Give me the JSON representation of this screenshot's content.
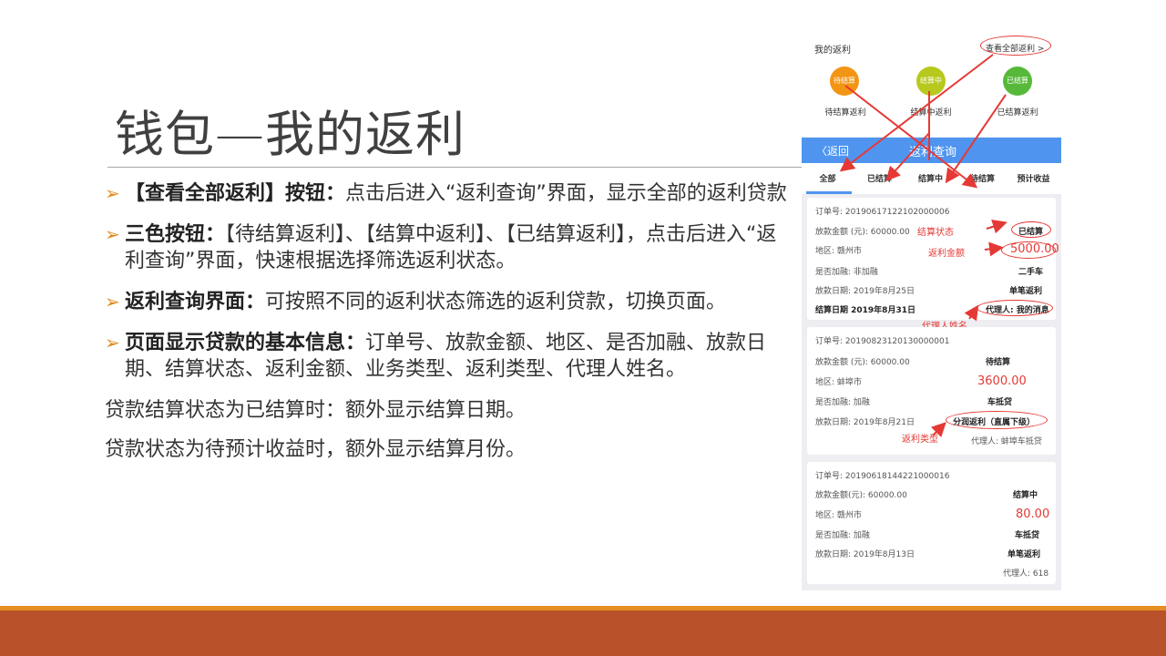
{
  "slide": {
    "title": "钱包—我的返利",
    "bullets": [
      {
        "bold": "【查看全部返利】按钮：",
        "text": "点击后进入“返利查询”界面，显示全部的返利贷款"
      },
      {
        "bold": "三色按钮：",
        "text": "【待结算返利】、【结算中返利】、【已结算返利】，点击后进入“返利查询”界面，快速根据选择筛选返利状态。"
      },
      {
        "bold": "返利查询界面：",
        "text": "可按照不同的返利状态筛选的返利贷款，切换页面。"
      },
      {
        "bold": "页面显示贷款的基本信息：",
        "text": "订单号、放款金额、地区、是否加融、放款日期、结算状态、返利金额、业务类型、返利类型、代理人姓名。"
      }
    ],
    "notes": [
      "贷款结算状态为已结算时：额外显示结算日期。",
      "贷款状态为待预计收益时，额外显示结算月份。"
    ]
  },
  "phone": {
    "rebate_title": "我的返利",
    "view_all": "查看全部返利 >",
    "circles": [
      {
        "text": "待结算",
        "label": "待结算返利",
        "color": "#f39514"
      },
      {
        "text": "结算中",
        "label": "结算中返利",
        "color": "#b7c91c"
      },
      {
        "text": "已结算",
        "label": "已结算返利",
        "color": "#57b93a"
      }
    ],
    "nav": {
      "back": "〈返回",
      "title": "返利查询"
    },
    "tabs": [
      "全部",
      "已结算",
      "结算中",
      "待结算",
      "预计收益"
    ],
    "cards": [
      {
        "order": "订单号: 20190617122102000006",
        "amount": "放款金额 (元): 60000.00",
        "region": "地区: 赣州市",
        "extra": "是否加融: 非加融",
        "loan_date": "放款日期: 2019年8月25日",
        "settle_date": "结算日期 2019年8月31日",
        "status": "已结算",
        "rebate": "5000.00",
        "biz": "二手车",
        "rebate_type": "单笔返利",
        "agent": "代理人: 我的消息"
      },
      {
        "order": "订单号: 20190823120130000001",
        "amount": "放款金额 (元): 60000.00",
        "region": "地区: 蚌埠市",
        "extra": "是否加融: 加融",
        "loan_date": "放款日期: 2019年8月21日",
        "status": "待结算",
        "rebate": "3600.00",
        "biz": "车抵贷",
        "rebate_type": "分润返利（直属下级）",
        "agent": "代理人: 蚌埠车抵贷"
      },
      {
        "order": "订单号: 20190618144221000016",
        "amount": "放款金额(元): 60000.00",
        "region": "地区: 赣州市",
        "extra": "是否加融: 加融",
        "loan_date": "放款日期: 2019年8月13日",
        "status": "结算中",
        "rebate": "80.00",
        "biz": "车抵贷",
        "rebate_type": "单笔返利",
        "agent": "代理人: 618"
      }
    ],
    "annotations": {
      "settle_status": "结算状态",
      "rebate_amount": "返利金额",
      "agent_name": "代理人姓名",
      "rebate_type": "返利类型"
    },
    "accent": "#4f95f0",
    "annotation_color": "#e53935"
  },
  "colors": {
    "bar_thin": "#e58e21",
    "bar_thick": "#b9522b",
    "bullet_arrow": "#e08a1a"
  }
}
